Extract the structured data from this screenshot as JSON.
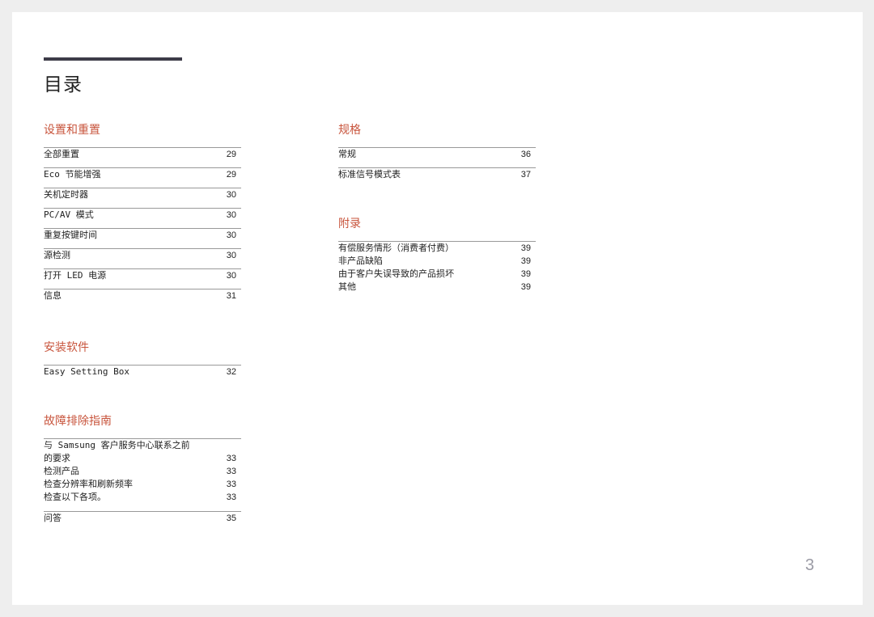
{
  "title": "目录",
  "page_number": "3",
  "colors": {
    "accent": "#c8553d",
    "bar": "#3d3b48"
  },
  "sections": {
    "setup": {
      "heading": "设置和重置",
      "items": [
        {
          "label": "全部重置",
          "page": "29"
        },
        {
          "label": "Eco 节能增强",
          "page": "29"
        },
        {
          "label": "关机定时器",
          "page": "30"
        },
        {
          "label": "PC/AV 模式",
          "page": "30"
        },
        {
          "label": "重复按键时间",
          "page": "30"
        },
        {
          "label": "源检测",
          "page": "30"
        },
        {
          "label": "打开 LED 电源",
          "page": "30"
        },
        {
          "label": "信息",
          "page": "31"
        }
      ]
    },
    "software": {
      "heading": "安装软件",
      "items": [
        {
          "label": "Easy Setting Box",
          "page": "32"
        }
      ]
    },
    "troubleshoot": {
      "heading": "故障排除指南",
      "intro": "与 Samsung 客户服务中心联系之前",
      "items": [
        {
          "label": "的要求",
          "page": "33"
        },
        {
          "label": "检测产品",
          "page": "33"
        },
        {
          "label": "检查分辨率和刷新频率",
          "page": "33"
        },
        {
          "label": "检查以下各项。",
          "page": "33"
        }
      ],
      "faq": {
        "label": "问答",
        "page": "35"
      }
    },
    "specs": {
      "heading": "规格",
      "items": [
        {
          "label": "常规",
          "page": "36"
        },
        {
          "label": "标准信号模式表",
          "page": "37"
        }
      ]
    },
    "appendix": {
      "heading": "附录",
      "items": [
        {
          "label": "有偿服务情形（消费者付费）",
          "page": "39"
        },
        {
          "label": "非产品缺陷",
          "page": "39"
        },
        {
          "label": "由于客户失误导致的产品损坏",
          "page": "39"
        },
        {
          "label": "其他",
          "page": "39"
        }
      ]
    }
  }
}
